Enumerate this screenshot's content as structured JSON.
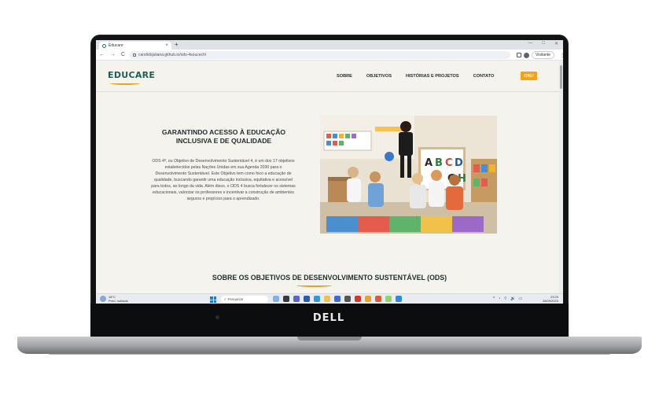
{
  "browser": {
    "tab_title": "Educare",
    "tab_close": "×",
    "new_tab": "+",
    "window_controls": [
      "—",
      "□",
      "✕"
    ],
    "nav": [
      "←",
      "→",
      "C"
    ],
    "url": "candidojuliana.github.io/ods-4soucech/",
    "profile_name": "Visitante",
    "menu_glyph": "⋮"
  },
  "site": {
    "logo": "EDUCARE",
    "menu": [
      "SOBRE",
      "OBJETIVOS",
      "HISTÓRIAS E PROJETOS",
      "CONTATO"
    ],
    "onu_button": "ONU",
    "hero_title": "GARANTINDO ACESSO À EDUCAÇÃO INCLUSIVA E DE QUALIDADE",
    "hero_text": "ODS 4ª, ou Objetivo de Desenvolvimento Sustentável 4, é um dos 17 objetivos estabelecidos pelas Nações Unidas em sua Agenda 2030 para o Desenvolvimento Sustentável. Este Objetivo tem como foco a educação de qualidade, buscando garantir uma educação inclusiva, equitativa e acessível para todos, ao longo da vida. Além disso, o ODS 4 busca fortalecer os sistemas educacionais, valorizar os professores e incentivar a construção de ambientes seguros e propícios para o aprendizado.",
    "photo_letters": [
      "A",
      "B",
      "C",
      "D",
      "G",
      "H"
    ],
    "section_title": "SOBRE OS OBJETIVOS DE DESENVOLVIMENTO SUSTENTÁVEL (ODS)"
  },
  "taskbar": {
    "weather_temp": "18°C",
    "weather_desc": "Pred. nublado",
    "search_placeholder": "Pesquisar",
    "time": "23:29",
    "date": "28/09/2023",
    "tray_glyphs": [
      "^",
      "◔",
      "⌔",
      "🔊",
      "▭"
    ]
  },
  "device": {
    "brand": "DELL"
  },
  "colors": {
    "brand_green": "#1f5e52",
    "accent_orange": "#f2a21b"
  }
}
